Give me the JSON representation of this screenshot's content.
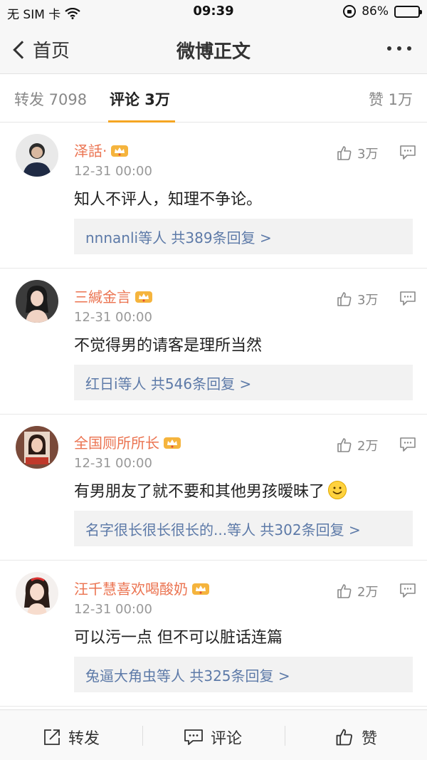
{
  "status": {
    "carrier": "无 SIM 卡",
    "time": "09:39",
    "battery": "86%",
    "battery_level": 0.86
  },
  "nav": {
    "back_label": "首页",
    "title": "微博正文"
  },
  "tabs": {
    "repost": "转发 7098",
    "comment": "评论 3万",
    "like": "赞 1万"
  },
  "comments": [
    {
      "name": "泽話·",
      "time": "12-31 00:00",
      "likes": "3万",
      "text": "知人不评人，知理不争论。",
      "replies": "nnnanli等人  共389条回复 >"
    },
    {
      "name": "三緘金言",
      "time": "12-31 00:00",
      "likes": "3万",
      "text": "不觉得男的请客是理所当然",
      "replies": "红日i等人  共546条回复 >"
    },
    {
      "name": "全国厕所所长",
      "time": "12-31 00:00",
      "likes": "2万",
      "text": "有男朋友了就不要和其他男孩暧昧了",
      "replies": "名字很长很长很长的...等人  共302条回复 >"
    },
    {
      "name": "汪千慧喜欢喝酸奶",
      "time": "12-31 00:00",
      "likes": "2万",
      "text": "可以污一点  但不可以脏话连篇",
      "replies": "兔逼大角虫等人  共325条回复 >"
    }
  ],
  "bottom": {
    "repost": "转发",
    "comment": "评论",
    "like": "赞"
  },
  "colors": {
    "accent": "#f5a623",
    "username": "#eb7350",
    "link": "#5d7aa8"
  }
}
